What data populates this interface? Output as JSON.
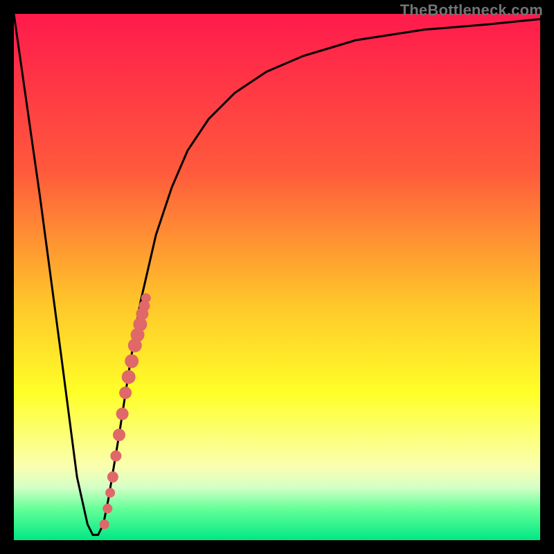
{
  "watermark": "TheBottleneck.com",
  "colors": {
    "frame": "#000000",
    "curve": "#000000",
    "marker": "#e06868",
    "gradient_stops": [
      {
        "offset": 0,
        "color": "#ff1a4c"
      },
      {
        "offset": 30,
        "color": "#ff5a3c"
      },
      {
        "offset": 55,
        "color": "#ffc62a"
      },
      {
        "offset": 72,
        "color": "#ffff28"
      },
      {
        "offset": 86,
        "color": "#faffb0"
      },
      {
        "offset": 90,
        "color": "#d4ffc6"
      },
      {
        "offset": 94,
        "color": "#66ff99"
      },
      {
        "offset": 100,
        "color": "#00e884"
      }
    ]
  },
  "chart_data": {
    "type": "line",
    "title": "",
    "xlabel": "",
    "ylabel": "",
    "xlim": [
      0,
      100
    ],
    "ylim": [
      0,
      100
    ],
    "grid": false,
    "curve": {
      "x": [
        0,
        5,
        9,
        12,
        14,
        15,
        16,
        17,
        18,
        20,
        22,
        24,
        27,
        30,
        33,
        37,
        42,
        48,
        55,
        65,
        78,
        90,
        100
      ],
      "y": [
        100,
        65,
        35,
        12,
        3,
        1,
        1,
        3,
        8,
        20,
        33,
        45,
        58,
        67,
        74,
        80,
        85,
        89,
        92,
        95,
        97,
        98,
        99
      ]
    },
    "markers": {
      "x": [
        17.2,
        17.8,
        18.3,
        18.8,
        19.4,
        20.0,
        20.6,
        21.2,
        21.8,
        22.4,
        23.0,
        23.5,
        24.0,
        24.4,
        24.8,
        25.1
      ],
      "y": [
        3,
        6,
        9,
        12,
        16,
        20,
        24,
        28,
        31,
        34,
        37,
        39,
        41,
        43,
        44.5,
        46
      ],
      "r": [
        7,
        7,
        7,
        8,
        8,
        9,
        9,
        9,
        10,
        10,
        10,
        10,
        10,
        9,
        8,
        7
      ]
    }
  }
}
